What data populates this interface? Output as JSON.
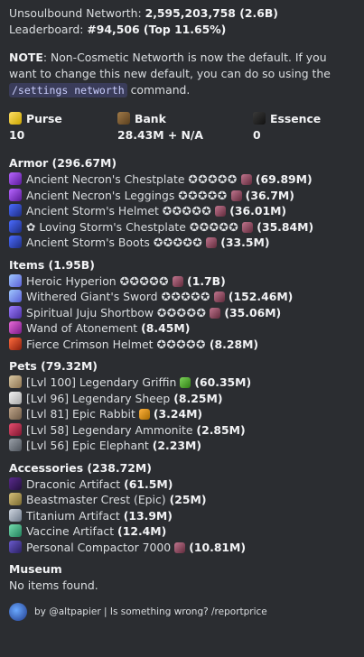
{
  "summary": {
    "networth_label": "Unsoulbound Networth: ",
    "networth_value": "2,595,203,758 (2.6B)",
    "leaderboard_label": "Leaderboard: ",
    "leaderboard_value": "#94,506 (Top 11.65%)"
  },
  "note": {
    "label": "NOTE",
    "text1": ": Non-Cosmetic Networth is now the default. If you want to change this new default, you can do so using the ",
    "command": "/settings networth",
    "text2": " command."
  },
  "fields": [
    {
      "icon": "gold-ingot-icon",
      "label": "Purse",
      "value": "10"
    },
    {
      "icon": "chest-icon",
      "label": "Bank",
      "value": "28.43M + N/A"
    },
    {
      "icon": "wither-essence-icon",
      "label": "Essence",
      "value": "0"
    }
  ],
  "armor": {
    "title": "Armor (296.67M)",
    "items": [
      {
        "name": "Ancient Necron's Chestplate",
        "stars": "✪✪✪✪✪",
        "value": "(69.89M)"
      },
      {
        "name": "Ancient Necron's Leggings",
        "stars": "✪✪✪✪✪",
        "value": "(36.7M)"
      },
      {
        "name": "Ancient Storm's Helmet",
        "stars": "✪✪✪✪✪",
        "value": "(36.01M)"
      },
      {
        "name": "✿ Loving Storm's Chestplate",
        "stars": "✪✪✪✪✪",
        "value": "(35.84M)"
      },
      {
        "name": "Ancient Storm's Boots",
        "stars": "✪✪✪✪✪",
        "value": "(33.5M)"
      }
    ]
  },
  "items": {
    "title": "Items (1.95B)",
    "items": [
      {
        "name": "Heroic Hyperion",
        "stars": "✪✪✪✪✪",
        "value": "(1.7B)"
      },
      {
        "name": "Withered Giant's Sword",
        "stars": "✪✪✪✪✪",
        "value": "(152.46M)"
      },
      {
        "name": "Spiritual Juju Shortbow",
        "stars": "✪✪✪✪✪",
        "value": "(35.06M)"
      },
      {
        "name": "Wand of Atonement",
        "stars": "",
        "value": "(8.45M)"
      },
      {
        "name": "Fierce Crimson Helmet",
        "stars": "✪✪✪✪✪",
        "value": "(8.28M)"
      }
    ]
  },
  "pets": {
    "title": "Pets (79.32M)",
    "items": [
      {
        "name": "[Lvl 100] Legendary Griffin",
        "value": "(60.35M)"
      },
      {
        "name": "[Lvl 96] Legendary Sheep",
        "value": "(8.25M)"
      },
      {
        "name": "[Lvl 81] Epic Rabbit",
        "value": "(3.24M)"
      },
      {
        "name": "[Lvl 58] Legendary Ammonite",
        "value": "(2.85M)"
      },
      {
        "name": "[Lvl 56] Epic Elephant",
        "value": "(2.23M)"
      }
    ]
  },
  "accessories": {
    "title": "Accessories (238.72M)",
    "items": [
      {
        "name": "Draconic Artifact",
        "value": "(61.5M)"
      },
      {
        "name": "Beastmaster Crest (Epic)",
        "value": "(25M)"
      },
      {
        "name": "Titanium Artifact",
        "value": "(13.9M)"
      },
      {
        "name": "Vaccine Artifact",
        "value": "(12.4M)"
      },
      {
        "name": "Personal Compactor 7000",
        "value": "(10.81M)"
      }
    ]
  },
  "museum": {
    "title": "Museum",
    "text": "No items found."
  },
  "footer": {
    "text": "by @altpapier | Is something wrong? /reportprice"
  }
}
